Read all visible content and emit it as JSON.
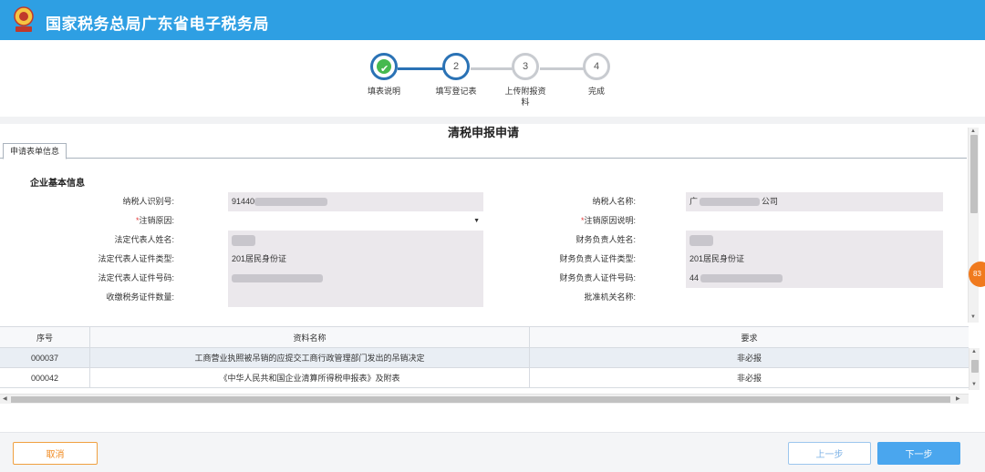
{
  "header": {
    "app_title": "国家税务总局广东省电子税务局",
    "logo_icon": "tax-emblem-icon"
  },
  "steps": [
    {
      "number": "✔",
      "label": "填表说明",
      "state": "done"
    },
    {
      "number": "2",
      "label": "填写登记表",
      "state": "active"
    },
    {
      "number": "3",
      "label": "上传附报资料",
      "state": "pending"
    },
    {
      "number": "4",
      "label": "完成",
      "state": "pending"
    }
  ],
  "form": {
    "title": "清税申报申请",
    "tab_label": "申请表单信息",
    "section_title": "企业基本信息",
    "required_mark": "*",
    "rows": [
      {
        "left_label": "纳税人识别号:",
        "left_value": "91440",
        "right_label": "纳税人名称:",
        "right_value_prefix": "广",
        "right_value_suffix": "公司"
      },
      {
        "left_label": "注销原因:",
        "right_label": "注销原因说明:"
      },
      {
        "left_label": "法定代表人姓名:",
        "left_value": "",
        "right_label": "财务负责人姓名:",
        "right_value": ""
      },
      {
        "left_label": "法定代表人证件类型:",
        "left_value": "201居民身份证",
        "right_label": "财务负责人证件类型:",
        "right_value": "201居民身份证"
      },
      {
        "left_label": "法定代表人证件号码:",
        "left_value": "",
        "right_label": "财务负责人证件号码:",
        "right_value": "44"
      },
      {
        "left_label": "收缴税务证件数量:",
        "left_value": "",
        "right_label": "批准机关名称:",
        "right_value": ""
      }
    ]
  },
  "attachments": {
    "columns": [
      "序号",
      "资料名称",
      "要求"
    ],
    "rows": [
      {
        "seq": "000037",
        "name": "工商营业执照被吊销的应提交工商行政管理部门发出的吊销决定",
        "requirement": "非必报"
      },
      {
        "seq": "000042",
        "name": "《中华人民共和国企业清算所得税申报表》及附表",
        "requirement": "非必报"
      }
    ]
  },
  "floating_badge": "83",
  "footer": {
    "cancel_label": "取消",
    "prev_label": "上一步",
    "next_label": "下一步"
  },
  "colors": {
    "header_blue": "#2e9fe3",
    "step_done_green": "#46b94f",
    "step_active_blue": "#2a72b5",
    "next_button": "#4aa6ee",
    "cancel_orange": "#f08a20",
    "required_red": "#e23b3b"
  }
}
